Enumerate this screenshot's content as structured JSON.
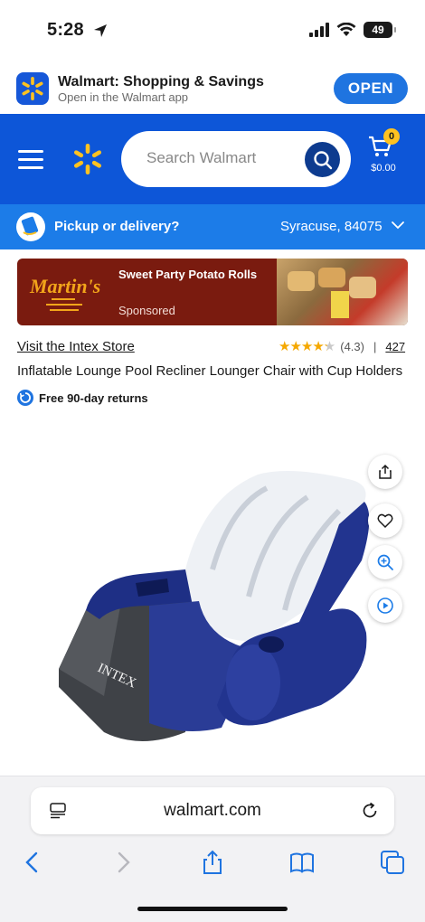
{
  "status_bar": {
    "time": "5:28",
    "battery": "49"
  },
  "app_banner": {
    "title": "Walmart: Shopping & Savings",
    "subtitle": "Open in the Walmart app",
    "open_label": "OPEN"
  },
  "header": {
    "search_placeholder": "Search Walmart",
    "cart_count": "0",
    "cart_total": "$0.00"
  },
  "pickup": {
    "label": "Pickup or delivery?",
    "location": "Syracuse, 84075"
  },
  "ad": {
    "title": "Sweet Party Potato Rolls",
    "sponsored": "Sponsored",
    "logo_text": "Martin's"
  },
  "product": {
    "store_link": "Visit the Intex Store",
    "rating_value": 4.3,
    "rating_text": "(4.3)",
    "separator": "|",
    "review_count": "427",
    "title": "Inflatable Lounge Pool Recliner Lounger Chair with Cup Holders",
    "returns": "Free 90-day returns",
    "brand_on_image": "INTEX"
  },
  "safari": {
    "url": "walmart.com"
  },
  "colors": {
    "header_blue": "#0d56d8",
    "pickup_blue": "#1c7ce8",
    "open_button": "#1f74e0",
    "spark_yellow": "#ffc220",
    "star": "#f5a800"
  }
}
